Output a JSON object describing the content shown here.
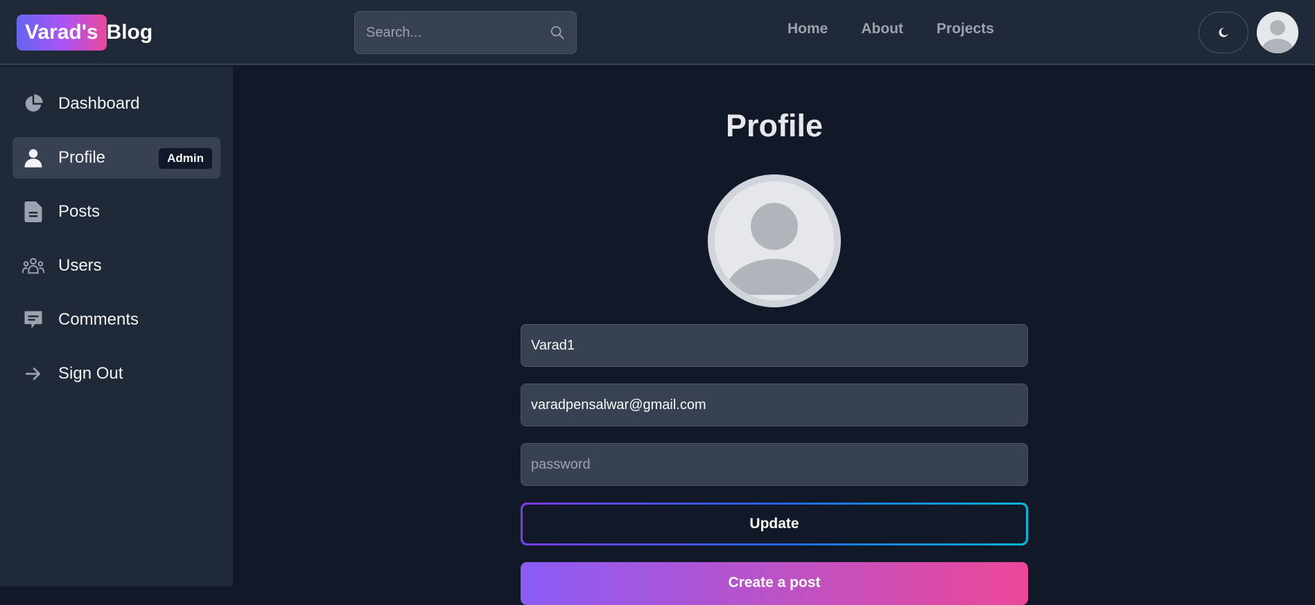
{
  "header": {
    "logo_badge": "Varad's",
    "logo_rest": "Blog",
    "search_placeholder": "Search...",
    "nav": [
      "Home",
      "About",
      "Projects"
    ],
    "theme_icon": "moon-icon",
    "avatar_icon": "user-avatar-icon"
  },
  "sidebar": {
    "items": [
      {
        "label": "Dashboard",
        "icon": "pie-chart-icon"
      },
      {
        "label": "Profile",
        "icon": "user-icon",
        "badge": "Admin",
        "active": true
      },
      {
        "label": "Posts",
        "icon": "document-icon"
      },
      {
        "label": "Users",
        "icon": "users-icon"
      },
      {
        "label": "Comments",
        "icon": "comment-icon"
      },
      {
        "label": "Sign Out",
        "icon": "arrow-right-icon"
      }
    ]
  },
  "main": {
    "title": "Profile",
    "username": "Varad1",
    "email": "varadpensalwar@gmail.com",
    "password_placeholder": "password",
    "update_label": "Update",
    "create_post_label": "Create a post"
  },
  "colors": {
    "background": "#111827",
    "panel": "#1f2937",
    "input": "#374151",
    "accent_gradient_start": "#8b5cf6",
    "accent_gradient_end": "#ec4899"
  }
}
